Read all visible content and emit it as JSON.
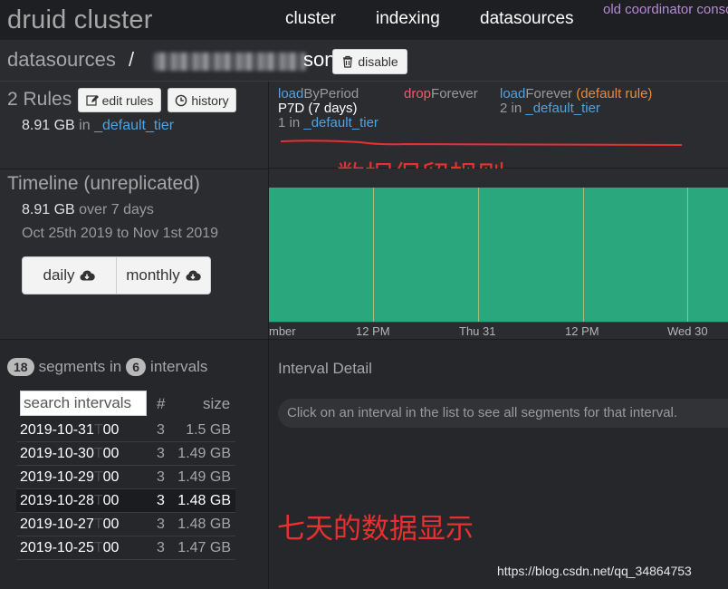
{
  "nav": {
    "brand": "druid cluster",
    "items": [
      "cluster",
      "indexing",
      "datasources"
    ],
    "old_coordinator": "old coordinator console"
  },
  "breadcrumb": {
    "datasources": "datasources",
    "separator": "/",
    "name_visible": "son",
    "disable_label": "disable"
  },
  "rules": {
    "title": "2 Rules",
    "edit_label": "edit rules",
    "history_label": "history",
    "size": "8.91 GB",
    "size_in": "in",
    "tier": "_default_tier",
    "list": [
      {
        "action": "load",
        "kind": "ByPeriod",
        "period": "P7D (7 days)",
        "replicas": "1 in",
        "tier": "_default_tier"
      },
      {
        "action": "drop",
        "kind": "Forever"
      },
      {
        "action": "load",
        "kind": "Forever",
        "note": "(default rule)",
        "replicas": "2 in",
        "tier": "_default_tier"
      }
    ],
    "annotation": "数据保留规则"
  },
  "timeline": {
    "title": "Timeline (unreplicated)",
    "size": "8.91 GB",
    "span": "over 7 days",
    "range": "Oct 25th 2019 to Nov 1st 2019",
    "daily_label": "daily",
    "monthly_label": "monthly",
    "ticks": [
      "mber",
      "12 PM",
      "Thu 31",
      "12 PM",
      "Wed 30"
    ],
    "bar_color": "#2aa77d"
  },
  "segments": {
    "segment_count": "18",
    "segments_in_label": "segments in",
    "interval_count": "6",
    "intervals_label": "intervals",
    "search_placeholder": "search intervals",
    "col_count": "#",
    "col_size": "size",
    "rows": [
      {
        "date": "2019-10-31",
        "t": "T",
        "hour": "00",
        "count": "3",
        "size": "1.5 GB"
      },
      {
        "date": "2019-10-30",
        "t": "T",
        "hour": "00",
        "count": "3",
        "size": "1.49 GB"
      },
      {
        "date": "2019-10-29",
        "t": "T",
        "hour": "00",
        "count": "3",
        "size": "1.49 GB"
      },
      {
        "date": "2019-10-28",
        "t": "T",
        "hour": "00",
        "count": "3",
        "size": "1.48 GB"
      },
      {
        "date": "2019-10-27",
        "t": "T",
        "hour": "00",
        "count": "3",
        "size": "1.48 GB"
      },
      {
        "date": "2019-10-25",
        "t": "T",
        "hour": "00",
        "count": "3",
        "size": "1.47 GB"
      }
    ],
    "annotation": "七天的数据显示"
  },
  "detail": {
    "title": "Interval Detail",
    "message": "Click on an interval in the list to see all segments for that interval."
  },
  "watermark": "https://blog.csdn.net/qq_34864753"
}
